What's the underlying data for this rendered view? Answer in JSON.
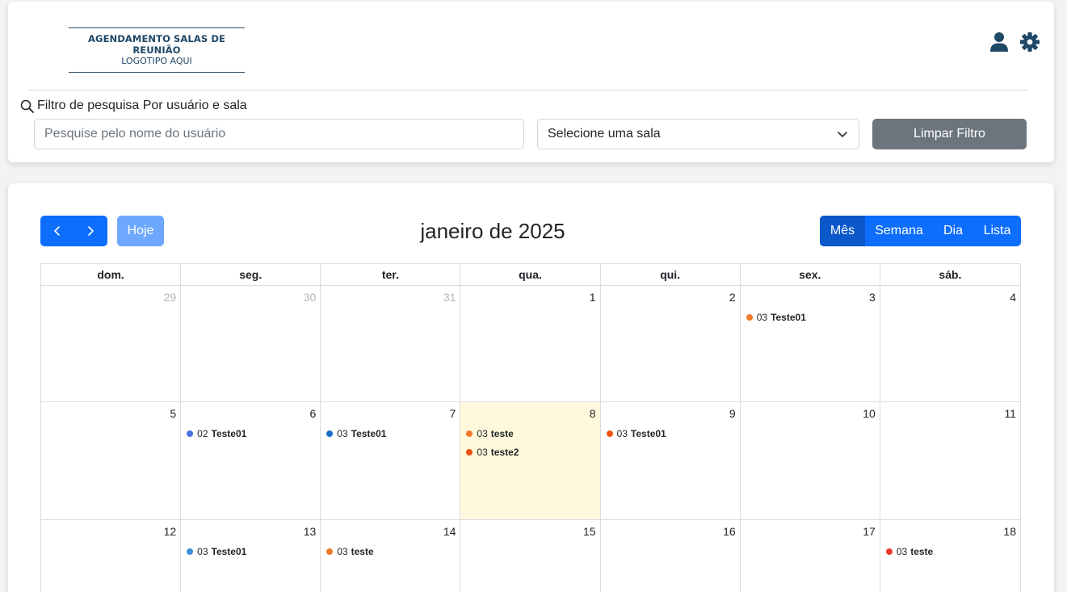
{
  "header": {
    "logo_line1": "AGENDAMENTO SALAS DE REUNIÃO",
    "logo_line2": "LOGOTIPO AQUI",
    "user_icon": "user-icon",
    "settings_icon": "gear-icon"
  },
  "filter": {
    "label": "Filtro de pesquisa Por usuário e sala",
    "search_placeholder": "Pesquise pelo nome do usuário",
    "room_select_value": "Selecione uma sala",
    "clear_button": "Limpar Filtro"
  },
  "calendar": {
    "title": "janeiro de 2025",
    "today_button": "Hoje",
    "views": [
      "Mês",
      "Semana",
      "Dia",
      "Lista"
    ],
    "active_view": "Mês",
    "weekdays": [
      "dom.",
      "seg.",
      "ter.",
      "qua.",
      "qui.",
      "sex.",
      "sáb."
    ],
    "weeks": [
      {
        "days": [
          {
            "num": "29",
            "other": true,
            "events": []
          },
          {
            "num": "30",
            "other": true,
            "events": []
          },
          {
            "num": "31",
            "other": true,
            "events": []
          },
          {
            "num": "1",
            "events": []
          },
          {
            "num": "2",
            "events": []
          },
          {
            "num": "3",
            "events": [
              {
                "time": "03",
                "title": "Teste01",
                "color": "#f07a2a"
              }
            ]
          },
          {
            "num": "4",
            "events": []
          }
        ]
      },
      {
        "days": [
          {
            "num": "5",
            "events": []
          },
          {
            "num": "6",
            "events": [
              {
                "time": "02",
                "title": "Teste01",
                "color": "#4a73e0"
              }
            ]
          },
          {
            "num": "7",
            "events": [
              {
                "time": "03",
                "title": "Teste01",
                "color": "#1a6fc4"
              }
            ]
          },
          {
            "num": "8",
            "today": true,
            "events": [
              {
                "time": "03",
                "title": "teste",
                "color": "#f07a2a"
              },
              {
                "time": "03",
                "title": "teste2",
                "color": "#f0520f"
              }
            ]
          },
          {
            "num": "9",
            "events": [
              {
                "time": "03",
                "title": "Teste01",
                "color": "#f0520f"
              }
            ]
          },
          {
            "num": "10",
            "events": []
          },
          {
            "num": "11",
            "events": []
          }
        ]
      },
      {
        "days": [
          {
            "num": "12",
            "events": []
          },
          {
            "num": "13",
            "events": [
              {
                "time": "03",
                "title": "Teste01",
                "color": "#3f8fd8"
              }
            ]
          },
          {
            "num": "14",
            "events": [
              {
                "time": "03",
                "title": "teste",
                "color": "#f07a2a"
              }
            ]
          },
          {
            "num": "15",
            "events": []
          },
          {
            "num": "16",
            "events": []
          },
          {
            "num": "17",
            "events": []
          },
          {
            "num": "18",
            "events": [
              {
                "time": "03",
                "title": "teste",
                "color": "#ee3a2a"
              }
            ]
          }
        ]
      }
    ]
  },
  "colors": {
    "primary": "#0d6efd",
    "primary_active": "#0a58ca",
    "today_disabled": "#6ea8fe",
    "secondary": "#6c757d",
    "today_cell": "#fff8dc",
    "icon_dark": "#1f4766"
  }
}
